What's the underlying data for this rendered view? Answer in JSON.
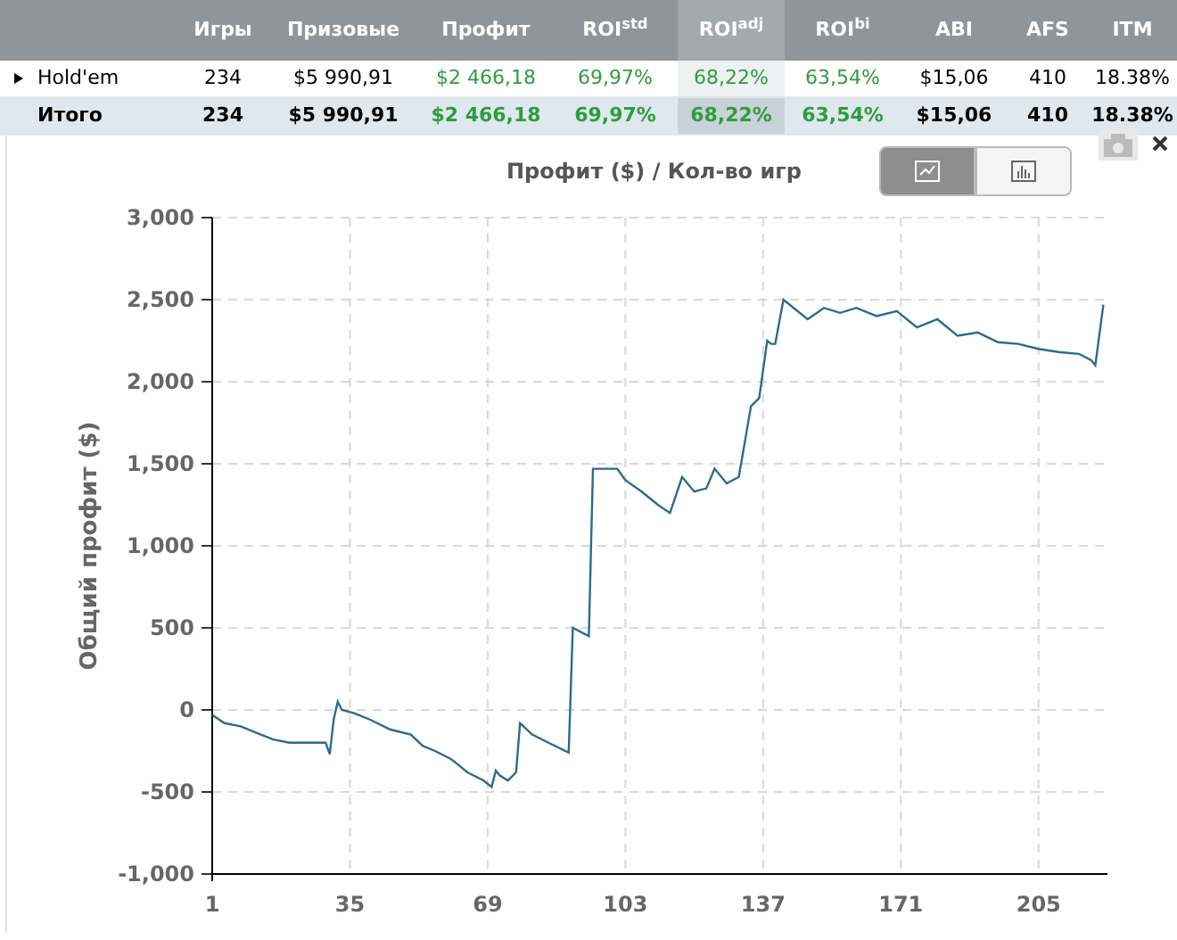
{
  "table": {
    "columns": [
      {
        "positive": false,
        "selected": false
      },
      {
        "label": "Игры",
        "positive": false,
        "selected": false
      },
      {
        "label": "Призовые",
        "positive": false,
        "selected": false
      },
      {
        "label": "Профит",
        "positive": true,
        "selected": false
      },
      {
        "label": "ROI$^{std}$",
        "positive": true,
        "selected": false
      },
      {
        "label": "ROI$^{adj}$",
        "positive": true,
        "selected": true
      },
      {
        "label": "ROI$^{bi}$",
        "positive": true,
        "selected": false
      },
      {
        "label": "ABI",
        "positive": false,
        "selected": false
      },
      {
        "label": "AFS",
        "positive": false,
        "selected": false
      },
      {
        "label": "ITM",
        "positive": false,
        "selected": false
      }
    ],
    "rows": [
      {
        "kind": "group",
        "expanded": false,
        "cells": [
          "Hold'em",
          "234",
          "$5 990,91",
          "$2 466,18",
          "69,97%",
          "68,22%",
          "63,54%",
          "$15,06",
          "410",
          "18.38%"
        ]
      },
      {
        "kind": "total",
        "cells": [
          "Итого",
          "234",
          "$5 990,91",
          "$2 466,18",
          "69,97%",
          "68,22%",
          "63,54%",
          "$15,06",
          "410",
          "18.38%"
        ]
      }
    ]
  },
  "chart_panel": {
    "title": "Профит ($) / Кол-во игр",
    "views": [
      {
        "kind": "line",
        "selected": true
      },
      {
        "kind": "bar",
        "selected": false
      }
    ],
    "chart_data": {
      "type": "line",
      "grid": true,
      "ylabel": "Общий профит ($)",
      "xlim": [
        1,
        222
      ],
      "ylim": [
        -1000,
        3000
      ],
      "xticks": [
        1,
        35,
        69,
        103,
        137,
        171,
        205
      ],
      "yticks": [
        {
          "value": -1000,
          "label": "-1,000"
        },
        {
          "value": -500,
          "label": "-500"
        },
        {
          "value": 0,
          "label": "0"
        },
        {
          "value": 500,
          "label": "500"
        },
        {
          "value": 1000,
          "label": "1,000"
        },
        {
          "value": 1500,
          "label": "1,500"
        },
        {
          "value": 2000,
          "label": "2,000"
        },
        {
          "value": 2500,
          "label": "2,500"
        },
        {
          "value": 3000,
          "label": "3,000"
        }
      ],
      "x": [
        1,
        4,
        8,
        12,
        16,
        20,
        25,
        29,
        30,
        31,
        32,
        33,
        36,
        40,
        45,
        50,
        53,
        56,
        60,
        64,
        68,
        70,
        71,
        72,
        74,
        76,
        77,
        80,
        84,
        89,
        90,
        94,
        95,
        96,
        101,
        103,
        107,
        111,
        114,
        117,
        120,
        123,
        125,
        128,
        131,
        134,
        136,
        138,
        139,
        140,
        142,
        145,
        148,
        152,
        156,
        160,
        165,
        170,
        175,
        180,
        185,
        190,
        195,
        200,
        205,
        210,
        215,
        218,
        219,
        221
      ],
      "series": [
        {
          "color": "#2b6c8e",
          "values": [
            -30,
            -80,
            -100,
            -140,
            -180,
            -200,
            -200,
            -200,
            -270,
            -60,
            50,
            0,
            -20,
            -60,
            -120,
            -150,
            -220,
            -250,
            -300,
            -380,
            -430,
            -470,
            -370,
            -400,
            -430,
            -380,
            -80,
            -150,
            -200,
            -260,
            500,
            450,
            1470,
            1470,
            1470,
            1400,
            1330,
            1250,
            1200,
            1420,
            1330,
            1350,
            1470,
            1380,
            1420,
            1850,
            1900,
            2250,
            2230,
            2230,
            2500,
            2440,
            2380,
            2450,
            2420,
            2450,
            2400,
            2430,
            2330,
            2380,
            2280,
            2300,
            2240,
            2230,
            2200,
            2180,
            2170,
            2130,
            2100,
            2470
          ]
        }
      ]
    }
  }
}
